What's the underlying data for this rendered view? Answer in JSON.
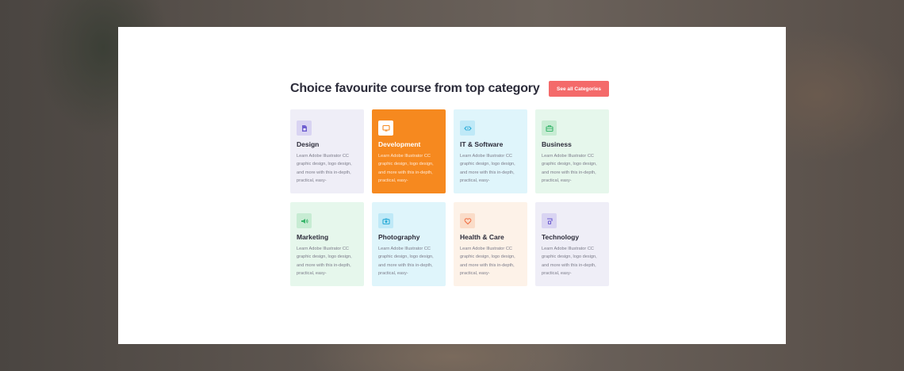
{
  "section": {
    "title": "Choice favourite course from top category",
    "see_all_label": "See all Categories",
    "accent_color": "#f46a6a"
  },
  "categories": [
    {
      "title": "Design",
      "desc": "Learn Adobe Illustrator CC graphic design, logo design, and more with this in-depth, practical, easy-",
      "icon": "design-file-icon",
      "bg": "#efeef7",
      "icon_bg": "#d9d4f2",
      "icon_color": "#6f5fd0",
      "active": false
    },
    {
      "title": "Development",
      "desc": "Learn Adobe Illustrator CC graphic design, logo design, and more with this in-depth, practical, easy-",
      "icon": "monitor-icon",
      "bg": "#f6891f",
      "icon_bg": "#ffffff",
      "icon_color": "#f6891f",
      "active": true
    },
    {
      "title": "IT & Software",
      "desc": "Learn Adobe Illustrator CC graphic design, logo design, and more with this in-depth, practical, easy-",
      "icon": "code-icon",
      "bg": "#dff5fb",
      "icon_bg": "#bfe9f7",
      "icon_color": "#26a9d6",
      "active": false
    },
    {
      "title": "Business",
      "desc": "Learn Adobe Illustrator CC graphic design, logo design, and more with this in-depth, practical, easy-",
      "icon": "briefcase-icon",
      "bg": "#e6f7ec",
      "icon_bg": "#c7ecd3",
      "icon_color": "#37b56a",
      "active": false
    },
    {
      "title": "Marketing",
      "desc": "Learn Adobe Illustrator CC graphic design, logo design, and more with this in-depth, practical, easy-",
      "icon": "megaphone-icon",
      "bg": "#e6f7ec",
      "icon_bg": "#c7ecd3",
      "icon_color": "#37b56a",
      "active": false
    },
    {
      "title": "Photography",
      "desc": "Learn Adobe Illustrator CC graphic design, logo design, and more with this in-depth, practical, easy-",
      "icon": "camera-icon",
      "bg": "#dff5fb",
      "icon_bg": "#bfe9f7",
      "icon_color": "#26a9d6",
      "active": false
    },
    {
      "title": "Health & Care",
      "desc": "Learn Adobe Illustrator CC graphic design, logo design, and more with this in-depth, practical, easy-",
      "icon": "heart-icon",
      "bg": "#fdf2e8",
      "icon_bg": "#fadcc8",
      "icon_color": "#f0744a",
      "active": false
    },
    {
      "title": "Technology",
      "desc": "Learn Adobe Illustrator CC graphic design, logo design, and more with this in-depth, practical, easy-",
      "icon": "device-icon",
      "bg": "#efeef7",
      "icon_bg": "#d9d4f2",
      "icon_color": "#6f5fd0",
      "active": false
    }
  ]
}
